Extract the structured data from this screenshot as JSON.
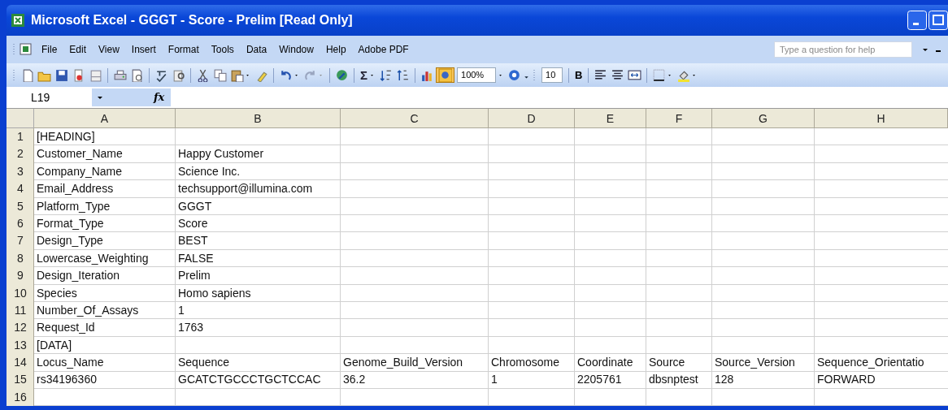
{
  "window": {
    "title": "Microsoft Excel - GGGT - Score - Prelim  [Read Only]"
  },
  "menu": [
    "File",
    "Edit",
    "View",
    "Insert",
    "Format",
    "Tools",
    "Data",
    "Window",
    "Help",
    "Adobe PDF"
  ],
  "help_box": {
    "placeholder": "Type a question for help"
  },
  "toolbar": {
    "autosum": "Σ",
    "zoom": "100%",
    "font_size": "10",
    "bold": "B"
  },
  "formula_bar": {
    "name_box": "L19",
    "fx": "fx"
  },
  "columns": [
    "A",
    "B",
    "C",
    "D",
    "E",
    "F",
    "G",
    "H"
  ],
  "rows": [
    {
      "number": "1",
      "cells": {
        "A": "[HEADING]"
      }
    },
    {
      "number": "2",
      "cells": {
        "A": "Customer_Name",
        "B": "Happy Customer"
      }
    },
    {
      "number": "3",
      "cells": {
        "A": "Company_Name",
        "B": "Science Inc."
      }
    },
    {
      "number": "4",
      "cells": {
        "A": "Email_Address",
        "B": "techsupport@illumina.com"
      }
    },
    {
      "number": "5",
      "cells": {
        "A": "Platform_Type",
        "B": "GGGT"
      }
    },
    {
      "number": "6",
      "cells": {
        "A": "Format_Type",
        "B": "Score"
      }
    },
    {
      "number": "7",
      "cells": {
        "A": "Design_Type",
        "B": "BEST"
      }
    },
    {
      "number": "8",
      "cells": {
        "A": "Lowercase_Weighting",
        "B": "FALSE"
      }
    },
    {
      "number": "9",
      "cells": {
        "A": "Design_Iteration",
        "B": "Prelim"
      }
    },
    {
      "number": "10",
      "cells": {
        "A": "Species",
        "B": "Homo sapiens"
      }
    },
    {
      "number": "11",
      "cells": {
        "A": "Number_Of_Assays",
        "B": "1"
      }
    },
    {
      "number": "12",
      "cells": {
        "A": "Request_Id",
        "B": "1763"
      }
    },
    {
      "number": "13",
      "cells": {
        "A": "[DATA]"
      }
    },
    {
      "number": "14",
      "cells": {
        "A": "Locus_Name",
        "B": "Sequence",
        "C": "Genome_Build_Version",
        "D": "Chromosome",
        "E": "Coordinate",
        "F": "Source",
        "G": "Source_Version",
        "H": "Sequence_Orientatio"
      }
    },
    {
      "number": "15",
      "cells": {
        "A": "rs34196360",
        "B": "GCATCTGCCCTGCTCCAC",
        "C": "36.2",
        "D": "1",
        "E": "2205761",
        "F": "dbsnptest",
        "G": "128",
        "H": "FORWARD"
      }
    },
    {
      "number": "16",
      "cells": {}
    }
  ]
}
